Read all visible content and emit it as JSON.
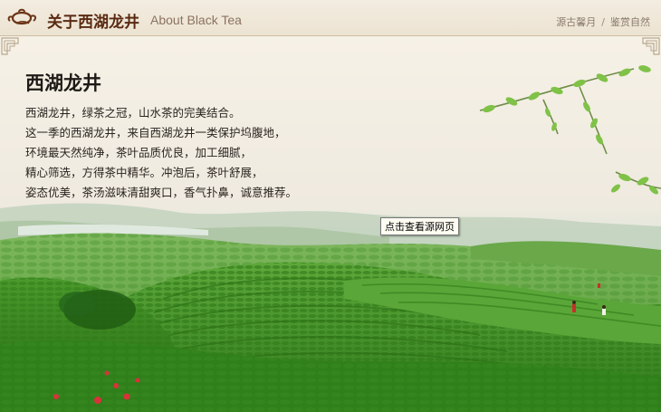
{
  "header": {
    "title_cn": "关于西湖龙井",
    "title_en": "About Black Tea",
    "links": [
      "源古馨月",
      "鉴赏自然"
    ],
    "separator": "/"
  },
  "article": {
    "heading": "西湖龙井",
    "lines": [
      "西湖龙井，绿茶之冠，山水茶的完美结合。",
      "这一季的西湖龙井，来自西湖龙井一类保护坞腹地，",
      "环境最天然纯净，茶叶品质优良，加工细腻，",
      "精心筛选，方得茶中精华。冲泡后，茶叶舒展，",
      "姿态优美，茶汤滋味清甜爽口，香气扑鼻，诚意推荐。"
    ]
  },
  "source_link": "点击查看源网页",
  "colors": {
    "brand": "#5a2a12",
    "header_bg": "#efe7d8",
    "tea_green": "#3f8f2a"
  },
  "icons": {
    "logo": "teapot-icon"
  }
}
